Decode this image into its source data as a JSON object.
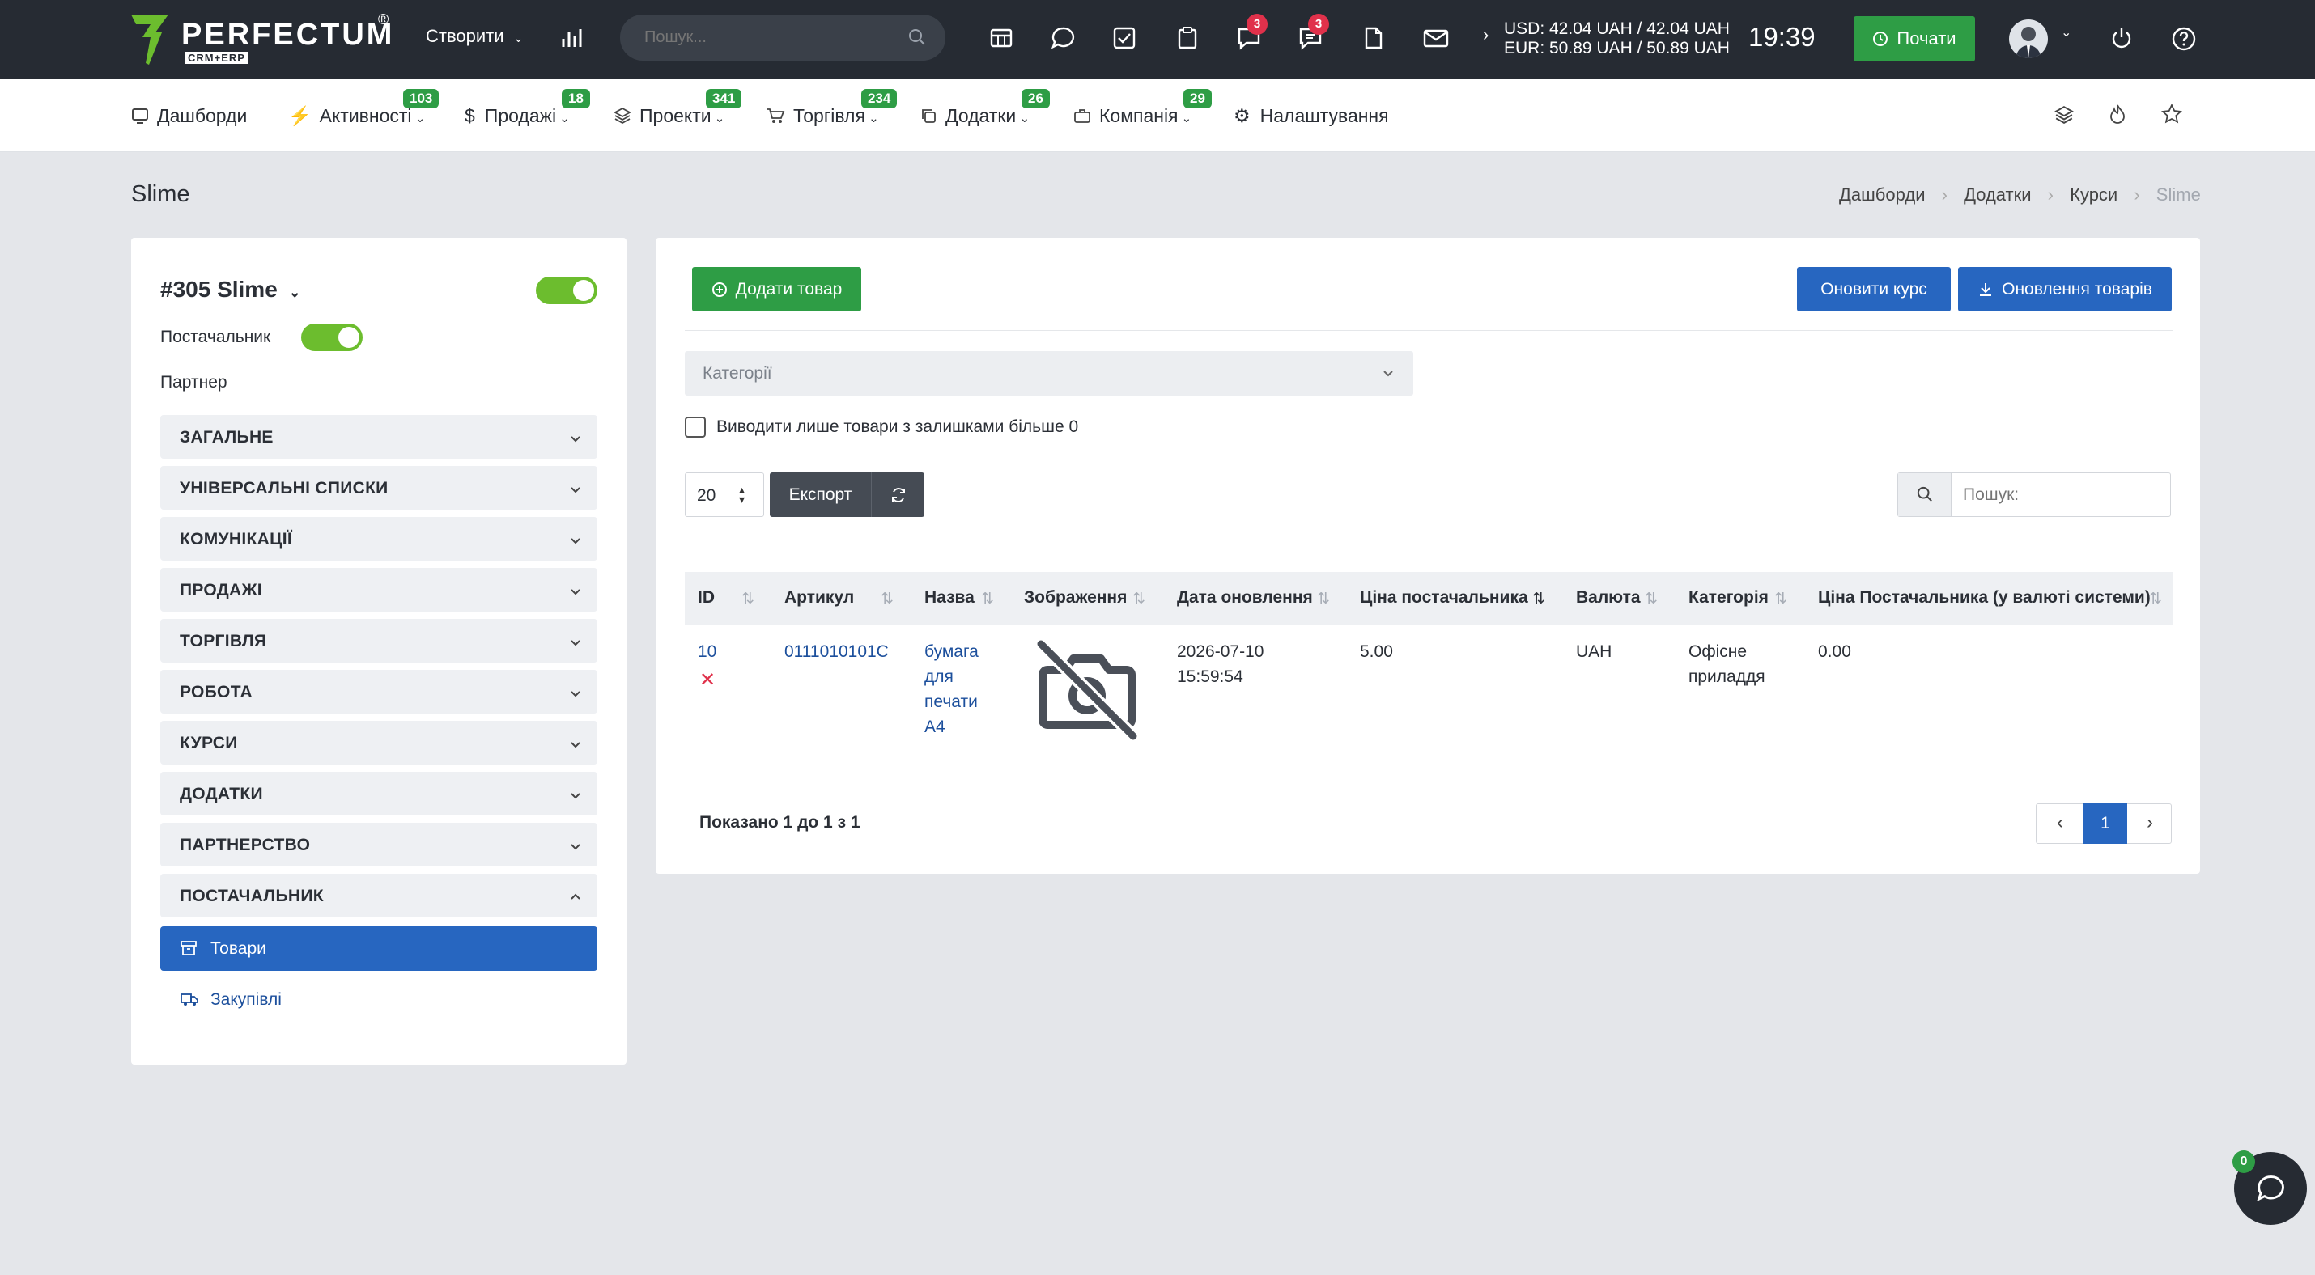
{
  "brand": {
    "name": "PERFECTUM",
    "sub": "CRM+ERP",
    "reg": "®"
  },
  "topbar": {
    "create_label": "Створити",
    "search_placeholder": "Пошук...",
    "badge_notifications": "3",
    "badge_messages": "3",
    "rates_usd": "USD: 42.04 UAH / 42.04 UAH",
    "rates_eur": "EUR: 50.89 UAH / 50.89 UAH",
    "time": "19:39",
    "start_label": "Почати"
  },
  "nav": {
    "items": [
      {
        "label": "Дашборди",
        "badge": ""
      },
      {
        "label": "Активності",
        "badge": "103"
      },
      {
        "label": "Продажі",
        "badge": "18"
      },
      {
        "label": "Проекти",
        "badge": "341"
      },
      {
        "label": "Торгівля",
        "badge": "234"
      },
      {
        "label": "Додатки",
        "badge": "26"
      },
      {
        "label": "Компанія",
        "badge": "29"
      },
      {
        "label": "Налаштування",
        "badge": ""
      }
    ]
  },
  "page": {
    "title": "Slime",
    "breadcrumb": [
      "Дашборди",
      "Додатки",
      "Курси",
      "Slime"
    ]
  },
  "sidebar": {
    "title": "#305 Slime",
    "supplier_label": "Постачальник",
    "partner_label": "Партнер",
    "sections": [
      "ЗАГАЛЬНЕ",
      "УНІВЕРСАЛЬНІ СПИСКИ",
      "КОМУНІКАЦІЇ",
      "ПРОДАЖІ",
      "ТОРГІВЛЯ",
      "РОБОТА",
      "КУРСИ",
      "ДОДАТКИ",
      "ПАРТНЕРСТВО",
      "ПОСТАЧАЛЬНИК"
    ],
    "sub_items": [
      "Товари",
      "Закупівлі"
    ]
  },
  "main": {
    "add_product": "Додати товар",
    "update_rate": "Оновити курс",
    "update_products": "Оновлення товарів",
    "categories_placeholder": "Категорії",
    "stock_filter_label": "Виводити лише товари з залишками більше 0",
    "page_size": "20",
    "export_label": "Експорт",
    "search_placeholder": "Пошук:",
    "columns": [
      "ID",
      "Артикул",
      "Назва",
      "Зображення",
      "Дата оновлення",
      "Ціна постачальника",
      "Валюта",
      "Категорія",
      "Ціна Постачальника (у валюті системи)"
    ],
    "rows": [
      {
        "id": "10",
        "sku": "0111010101C",
        "name": [
          "бумага",
          "для",
          "печати",
          "А4"
        ],
        "date": [
          "2026-07-10",
          "15:59:54"
        ],
        "price": "5.00",
        "currency": "UAH",
        "category": [
          "Офісне",
          "приладдя"
        ],
        "price_sys": "0.00"
      }
    ],
    "summary": "Показано 1 до 1 з 1",
    "current_page": "1"
  },
  "chat": {
    "badge": "0"
  },
  "colors": {
    "topbar": "#262b33",
    "green": "#2e9d45",
    "blue": "#2766c0",
    "toggle": "#6cbd2e"
  }
}
